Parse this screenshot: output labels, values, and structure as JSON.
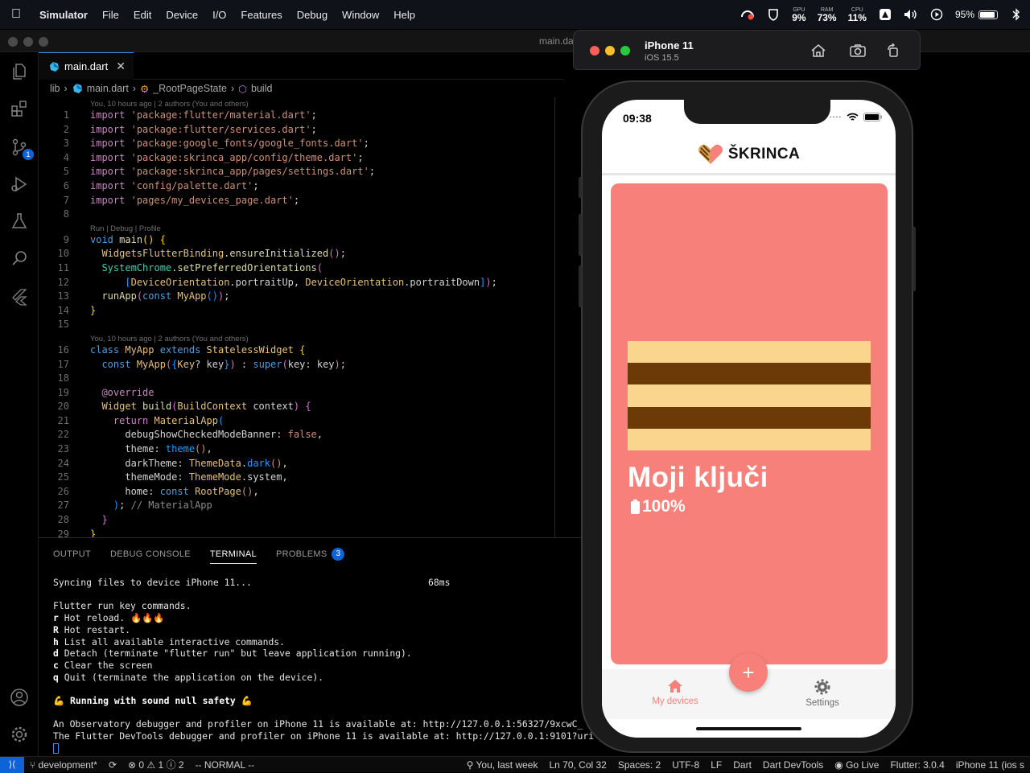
{
  "menubar": {
    "app": "Simulator",
    "items": [
      "File",
      "Edit",
      "Device",
      "I/O",
      "Features",
      "Debug",
      "Window",
      "Help"
    ],
    "gpu_label": "GPU",
    "gpu_value": "9%",
    "ram_label": "RAM",
    "ram_value": "73%",
    "cpu_label": "CPU",
    "cpu_value": "11%",
    "battery": "95%"
  },
  "editor": {
    "window_title": "main.da",
    "tab_label": "main.dart",
    "breadcrumb": [
      "lib",
      "main.dart",
      "_RootPageState",
      "build"
    ],
    "codelens_blame": "You, 10 hours ago | 2 authors (You and others)",
    "codelens_run": "Run | Debug | Profile"
  },
  "panel": {
    "tabs": [
      "OUTPUT",
      "DEBUG CONSOLE",
      "TERMINAL",
      "PROBLEMS"
    ],
    "problems_count": "3",
    "terminal": {
      "sync": "Syncing files to device iPhone 11...",
      "sync_time": "68ms",
      "keys_header": "Flutter run key commands.",
      "cmds": [
        {
          "k": "r",
          "t": " Hot reload. 🔥🔥🔥"
        },
        {
          "k": "R",
          "t": " Hot restart."
        },
        {
          "k": "h",
          "t": " List all available interactive commands."
        },
        {
          "k": "d",
          "t": " Detach (terminate \"flutter run\" but leave application running)."
        },
        {
          "k": "c",
          "t": " Clear the screen"
        },
        {
          "k": "q",
          "t": " Quit (terminate the application on the device)."
        }
      ],
      "null_safety": "💪 Running with sound null safety 💪",
      "observatory": "An Observatory debugger and profiler on iPhone 11 is available at: http://127.0.0.1:56327/9xcwC_",
      "devtools": "The Flutter DevTools debugger and profiler on iPhone 11 is available at: http://127.0.0.1:9101?uri"
    }
  },
  "statusbar": {
    "branch": "development*",
    "errors": "0",
    "warnings": "1",
    "infos": "2",
    "vim": "-- NORMAL --",
    "blame": "You, last week",
    "position": "Ln 70, Col 32",
    "spaces": "Spaces: 2",
    "encoding": "UTF-8",
    "eol": "LF",
    "language": "Dart",
    "devtools": "Dart DevTools",
    "golive": "Go Live",
    "flutter": "Flutter: 3.0.4",
    "device": "iPhone 11 (ios s"
  },
  "simulator": {
    "device": "iPhone 11",
    "os": "iOS 15.5"
  },
  "phone": {
    "time": "09:38",
    "brand": "ŠKRINCA",
    "card_title": "Moji ključi",
    "battery": "100%",
    "nav": [
      {
        "label": "My devices"
      },
      {
        "label": "Settings"
      }
    ],
    "fab": "+",
    "colors": {
      "accent": "#f7807b",
      "stripe_light": "#f9d58d",
      "stripe_dark": "#6b3a07"
    }
  }
}
